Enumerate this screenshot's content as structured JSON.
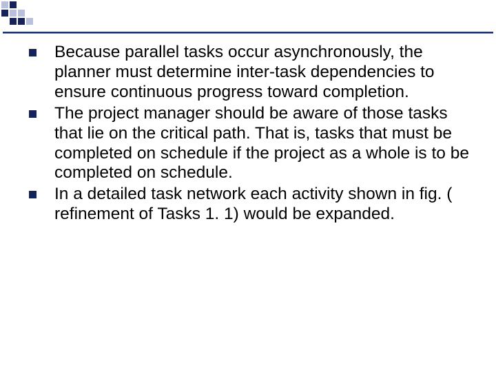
{
  "bullets": [
    "Because parallel tasks occur asynchronously, the planner must determine inter-task dependencies to ensure continuous progress toward completion.",
    "The project manager should be aware of those tasks that lie on the critical path. That is, tasks that must be completed on schedule if the project as a whole is to be completed on schedule.",
    "In a detailed task network each activity shown in fig. ( refinement of Tasks 1. 1) would be expanded."
  ],
  "deco_colors": {
    "dark": "#16235a",
    "light": "#b8c0dc",
    "mid": "#6b7bb0"
  }
}
